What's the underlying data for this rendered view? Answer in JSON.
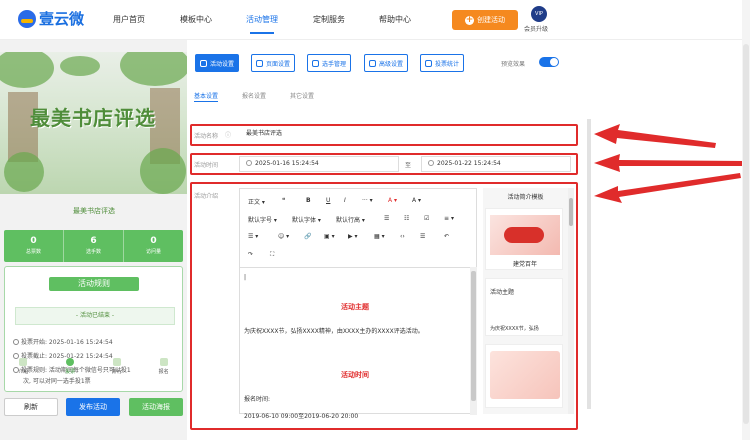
{
  "logo": {
    "text": "壹云微"
  },
  "nav": [
    {
      "label": "用户首页"
    },
    {
      "label": "模板中心"
    },
    {
      "label": "活动管理",
      "active": true
    },
    {
      "label": "定制服务"
    },
    {
      "label": "帮助中心"
    }
  ],
  "header": {
    "create_label": "创建活动",
    "vip_badge": "VIP",
    "vip_label": "会员升级"
  },
  "preview": {
    "cover_title": "最美书店评选",
    "card_title": "最美书店评选",
    "stats": [
      {
        "value": "0",
        "label": "总票数"
      },
      {
        "value": "6",
        "label": "选手数"
      },
      {
        "value": "0",
        "label": "访问量"
      }
    ],
    "rules_title": "活动规则",
    "ended_label": "- 活动已结束 -",
    "lines": [
      "投票开始: 2025-01-16 15:24:54",
      "投票截止: 2025-01-22 15:24:54",
      "投票规则: 活动期间每个微信号只可以投1",
      "次, 可以对同一选手投1票"
    ],
    "bottom_nav": [
      "介绍",
      "投票",
      "排行",
      "报名"
    ],
    "buttons": {
      "refresh": "刷新",
      "publish": "发布活动",
      "poster": "活动海报"
    }
  },
  "toolbar_tabs": [
    "活动设置",
    "页面设置",
    "选手管理",
    "高级设置",
    "投票统计"
  ],
  "preview_toggle_label": "预览效果",
  "sub_tabs": [
    "基本设置",
    "报名设置",
    "其它设置"
  ],
  "form": {
    "name_label": "活动名称",
    "name_value": "最美书店评选",
    "time_label": "活动时间",
    "time_start": "2025-01-16 15:24:54",
    "time_sep": "至",
    "time_end": "2025-01-22 15:24:54",
    "intro_label": "活动介绍"
  },
  "editor": {
    "tools_row1": [
      "正文",
      "❝",
      "B",
      "U",
      "I",
      "···",
      "A",
      "A"
    ],
    "tools_row2": [
      "默认字号",
      "默认字体",
      "默认行高",
      "☰",
      "☷",
      "☑",
      "≡"
    ],
    "tools_row3": [
      "☰",
      "☺",
      "🔗",
      "▣",
      "▶",
      "▦",
      "‹›",
      "☰",
      "↶"
    ],
    "tools_row4": [
      "↷",
      "⛶"
    ],
    "heading1": "活动主题",
    "para1": "为庆祝XXXX节，弘扬XXXX精神，由XXXX主办的XXXX评选活动。",
    "heading2": "活动时间",
    "para2": "报名时间:",
    "para3": "2019-06-10 09:00至2019-06-20 20:00"
  },
  "templates": {
    "title": "活动简介模板",
    "card1_caption": "建党百年",
    "card2_title": "活动主题",
    "card2_text": "为庆祝XXXX节，弘扬"
  },
  "colors": {
    "accent": "#1a73e8",
    "green": "#5fbf61",
    "orange": "#f5891f",
    "annotation": "#e02b2b"
  }
}
